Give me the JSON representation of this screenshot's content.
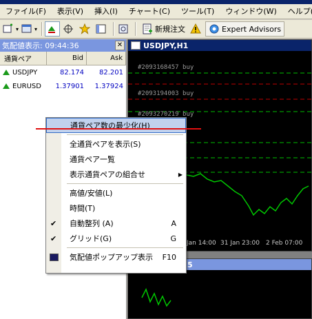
{
  "menubar": {
    "items": [
      "ファイル(F)",
      "表示(V)",
      "挿入(I)",
      "チャート(C)",
      "ツール(T)",
      "ウィンドウ(W)",
      "ヘルプ(H)"
    ]
  },
  "toolbar": {
    "new_order_label": "新規注文",
    "expert_advisors_label": "Expert Advisors"
  },
  "market_watch": {
    "title": "気配値表示: 09:44:36",
    "columns": {
      "symbol": "通貨ペア",
      "bid": "Bid",
      "ask": "Ask"
    },
    "rows": [
      {
        "symbol": "USDJPY",
        "bid": "82.174",
        "ask": "82.201"
      },
      {
        "symbol": "EURUSD",
        "bid": "1.37901",
        "ask": "1.37924"
      }
    ]
  },
  "chart": {
    "title": "USDJPY,H1",
    "orders": [
      "#2093168457 buy",
      "#2093194003 buy",
      "#2093270219 buy"
    ],
    "time_labels": [
      "Jan 14:00",
      "31 Jan 23:00",
      "2 Feb 07:00"
    ],
    "second_title": "5"
  },
  "context_menu": {
    "items": [
      {
        "label": "通貨ペア数の最少化(H)",
        "shortcut": ""
      },
      {
        "label": "全通貨ペアを表示(S)",
        "shortcut": ""
      },
      {
        "label": "通貨ペア一覧",
        "shortcut": ""
      },
      {
        "label": "表示通貨ペアの組合せ",
        "shortcut": ""
      },
      {
        "label": "高値/安値(L)",
        "shortcut": ""
      },
      {
        "label": "時間(T)",
        "shortcut": ""
      },
      {
        "label": "自動整列 (A)",
        "shortcut": "A"
      },
      {
        "label": "グリッド(G)",
        "shortcut": "G"
      },
      {
        "label": "気配値ポップアップ表示",
        "shortcut": "F10"
      }
    ]
  },
  "colors": {
    "accent_red": "#e01010",
    "order_line_green": "#00c000",
    "order_line_red": "#c00000",
    "price_green": "#00c800"
  }
}
